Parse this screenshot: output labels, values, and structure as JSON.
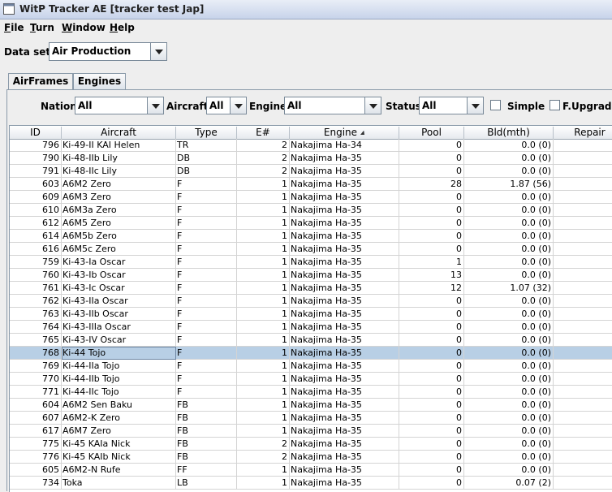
{
  "window": {
    "title": "WitP Tracker AE [tracker test Jap]"
  },
  "menu": [
    "File",
    "Turn",
    "Window",
    "Help"
  ],
  "dataset": {
    "label": "Data set:",
    "value": "Air Production"
  },
  "tabs": [
    {
      "label": "AirFrames",
      "active": true
    },
    {
      "label": "Engines",
      "active": false
    }
  ],
  "filters": {
    "nation": {
      "label": "Nation:",
      "value": "All"
    },
    "aircraft": {
      "label": "Aircraft:",
      "value": "All"
    },
    "engine": {
      "label": "Engine:",
      "value": "All"
    },
    "status": {
      "label": "Status:",
      "value": "All"
    },
    "simple": {
      "label": "Simple",
      "checked": false
    },
    "fupgrades": {
      "label": "F.Upgrades",
      "checked": false
    }
  },
  "table": {
    "columns": [
      "ID",
      "Aircraft",
      "Type",
      "E#",
      "Engine",
      "Pool",
      "Bld(mth)",
      "Repair"
    ],
    "sorted_column": "Engine",
    "selected_row": 16,
    "rows": [
      [
        "796",
        "Ki-49-II KAI Helen",
        "TR",
        "2",
        "Nakajima Ha-34",
        "0",
        "0.0 (0)",
        ""
      ],
      [
        "790",
        "Ki-48-IIb Lily",
        "DB",
        "2",
        "Nakajima Ha-35",
        "0",
        "0.0 (0)",
        ""
      ],
      [
        "791",
        "Ki-48-IIc Lily",
        "DB",
        "2",
        "Nakajima Ha-35",
        "0",
        "0.0 (0)",
        ""
      ],
      [
        "603",
        "A6M2 Zero",
        "F",
        "1",
        "Nakajima Ha-35",
        "28",
        "1.87 (56)",
        ""
      ],
      [
        "609",
        "A6M3 Zero",
        "F",
        "1",
        "Nakajima Ha-35",
        "0",
        "0.0 (0)",
        ""
      ],
      [
        "610",
        "A6M3a Zero",
        "F",
        "1",
        "Nakajima Ha-35",
        "0",
        "0.0 (0)",
        ""
      ],
      [
        "612",
        "A6M5 Zero",
        "F",
        "1",
        "Nakajima Ha-35",
        "0",
        "0.0 (0)",
        ""
      ],
      [
        "614",
        "A6M5b Zero",
        "F",
        "1",
        "Nakajima Ha-35",
        "0",
        "0.0 (0)",
        ""
      ],
      [
        "616",
        "A6M5c Zero",
        "F",
        "1",
        "Nakajima Ha-35",
        "0",
        "0.0 (0)",
        ""
      ],
      [
        "759",
        "Ki-43-Ia Oscar",
        "F",
        "1",
        "Nakajima Ha-35",
        "1",
        "0.0 (0)",
        ""
      ],
      [
        "760",
        "Ki-43-Ib Oscar",
        "F",
        "1",
        "Nakajima Ha-35",
        "13",
        "0.0 (0)",
        ""
      ],
      [
        "761",
        "Ki-43-Ic Oscar",
        "F",
        "1",
        "Nakajima Ha-35",
        "12",
        "1.07 (32)",
        ""
      ],
      [
        "762",
        "Ki-43-IIa Oscar",
        "F",
        "1",
        "Nakajima Ha-35",
        "0",
        "0.0 (0)",
        ""
      ],
      [
        "763",
        "Ki-43-IIb Oscar",
        "F",
        "1",
        "Nakajima Ha-35",
        "0",
        "0.0 (0)",
        ""
      ],
      [
        "764",
        "Ki-43-IIIa Oscar",
        "F",
        "1",
        "Nakajima Ha-35",
        "0",
        "0.0 (0)",
        ""
      ],
      [
        "765",
        "Ki-43-IV Oscar",
        "F",
        "1",
        "Nakajima Ha-35",
        "0",
        "0.0 (0)",
        ""
      ],
      [
        "768",
        "Ki-44 Tojo",
        "F",
        "1",
        "Nakajima Ha-35",
        "0",
        "0.0 (0)",
        ""
      ],
      [
        "769",
        "Ki-44-IIa Tojo",
        "F",
        "1",
        "Nakajima Ha-35",
        "0",
        "0.0 (0)",
        ""
      ],
      [
        "770",
        "Ki-44-IIb Tojo",
        "F",
        "1",
        "Nakajima Ha-35",
        "0",
        "0.0 (0)",
        ""
      ],
      [
        "771",
        "Ki-44-IIc Tojo",
        "F",
        "1",
        "Nakajima Ha-35",
        "0",
        "0.0 (0)",
        ""
      ],
      [
        "604",
        "A6M2 Sen Baku",
        "FB",
        "1",
        "Nakajima Ha-35",
        "0",
        "0.0 (0)",
        ""
      ],
      [
        "607",
        "A6M2-K Zero",
        "FB",
        "1",
        "Nakajima Ha-35",
        "0",
        "0.0 (0)",
        ""
      ],
      [
        "617",
        "A6M7 Zero",
        "FB",
        "1",
        "Nakajima Ha-35",
        "0",
        "0.0 (0)",
        ""
      ],
      [
        "775",
        "Ki-45 KAIa Nick",
        "FB",
        "2",
        "Nakajima Ha-35",
        "0",
        "0.0 (0)",
        ""
      ],
      [
        "776",
        "Ki-45 KAIb Nick",
        "FB",
        "2",
        "Nakajima Ha-35",
        "0",
        "0.0 (0)",
        ""
      ],
      [
        "605",
        "A6M2-N Rufe",
        "FF",
        "1",
        "Nakajima Ha-35",
        "0",
        "0.0 (0)",
        ""
      ],
      [
        "734",
        "Toka",
        "LB",
        "1",
        "Nakajima Ha-35",
        "0",
        "0.07 (2)",
        ""
      ]
    ]
  }
}
